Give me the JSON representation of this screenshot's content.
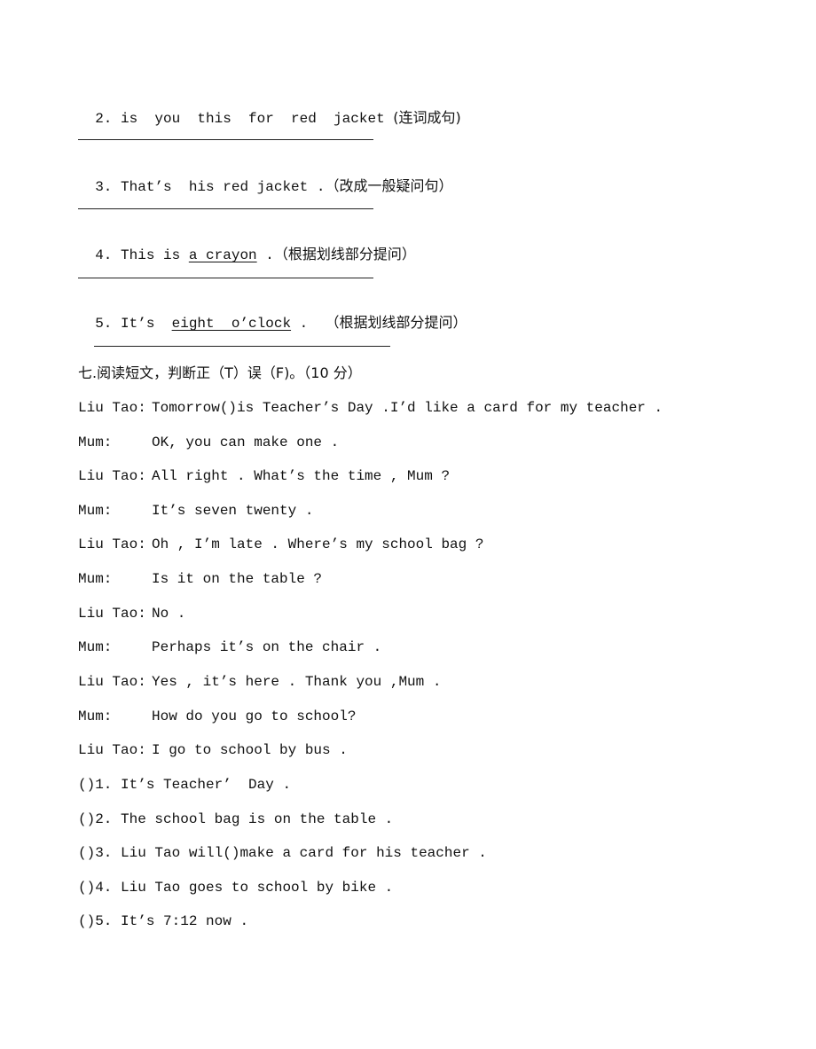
{
  "questions": [
    {
      "number": "2.",
      "text": "is  you  this  for  red  jacket",
      "instruction": "(连词成句)"
    },
    {
      "number": "3.",
      "text": "That’s  his red jacket .",
      "instruction": "（改成一般疑问句）"
    },
    {
      "number": "4.",
      "prefix": "This is ",
      "underlined": "a crayon",
      "suffix": " .",
      "instruction": "（根据划线部分提问）"
    },
    {
      "number": "5.",
      "prefix": "It’s  ",
      "underlined": "eight  o’clock",
      "suffix": " .  ",
      "instruction": "（根据划线部分提问）"
    }
  ],
  "section": {
    "title": "七.阅读短文，判断正（T）误（F)。（10 分）"
  },
  "dialogue": [
    {
      "speaker": "Liu Tao:",
      "line": "Tomorrow()is Teacher’s Day .I’d like a card for my teacher ."
    },
    {
      "speaker": "Mum:",
      "line": "OK, you can make one ."
    },
    {
      "speaker": "Liu Tao:",
      "line": "All right . What’s the time , Mum ?"
    },
    {
      "speaker": "Mum:",
      "line": "It’s seven twenty ."
    },
    {
      "speaker": "Liu Tao:",
      "line": "Oh , I’m late . Where’s my school bag ?"
    },
    {
      "speaker": "Mum:",
      "line": "Is it on the table ?"
    },
    {
      "speaker": "Liu Tao:",
      "line": "No ."
    },
    {
      "speaker": "Mum:",
      "line": "Perhaps it’s on the chair ."
    },
    {
      "speaker": "Liu Tao:",
      "line": "Yes , it’s here . Thank you ,Mum ."
    },
    {
      "speaker": "Mum:",
      "line": "How do you go to school?"
    },
    {
      "speaker": "Liu Tao:",
      "line": "I go to school by bus ."
    }
  ],
  "statements": [
    {
      "blank": "()",
      "number": "1.",
      "text": "It’s Teacher’  Day ."
    },
    {
      "blank": "()",
      "number": "2.",
      "text": "The school bag is on the table ."
    },
    {
      "blank": "()",
      "number": "3.",
      "text": "Liu Tao will()make a card for his teacher ."
    },
    {
      "blank": "()",
      "number": "4.",
      "text": "Liu Tao goes to school by bike ."
    },
    {
      "blank": "()",
      "number": "5.",
      "text": "It’s 7:12 now ."
    }
  ]
}
